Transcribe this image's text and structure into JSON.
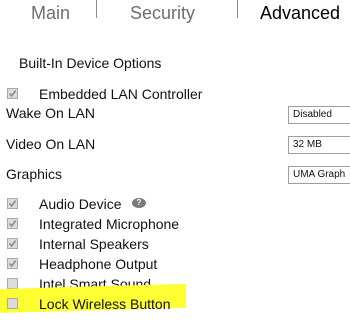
{
  "tabs": [
    {
      "label": "Main"
    },
    {
      "label": "Security"
    },
    {
      "label": "Advanced"
    }
  ],
  "active_tab": "Advanced",
  "section_title": "Built-In Device Options",
  "options": {
    "embedded_lan": {
      "label": "Embedded LAN Controller",
      "checked": true
    },
    "wake_on_lan": {
      "label": "Wake On LAN",
      "value": "Disabled"
    },
    "video_on_lan": {
      "label": "Video On LAN",
      "value": "32 MB"
    },
    "graphics": {
      "label": "Graphics",
      "value": "UMA Graph"
    },
    "audio_device": {
      "label": "Audio Device",
      "checked": true,
      "help": "?"
    },
    "integrated_microphone": {
      "label": "Integrated Microphone",
      "checked": true
    },
    "internal_speakers": {
      "label": "Internal Speakers",
      "checked": true
    },
    "headphone_output": {
      "label": "Headphone Output",
      "checked": true
    },
    "intel_smart_sound": {
      "label": "Intel Smart Sound",
      "checked": false
    },
    "lock_wireless_button": {
      "label": "Lock Wireless Button",
      "checked": false,
      "highlighted": true
    }
  },
  "colors": {
    "highlight": "#ffff33",
    "checkbox_fill": "#dcdcdc",
    "checkmark": "#8a8a8a",
    "inactive_tab": "#6e6e6e"
  }
}
